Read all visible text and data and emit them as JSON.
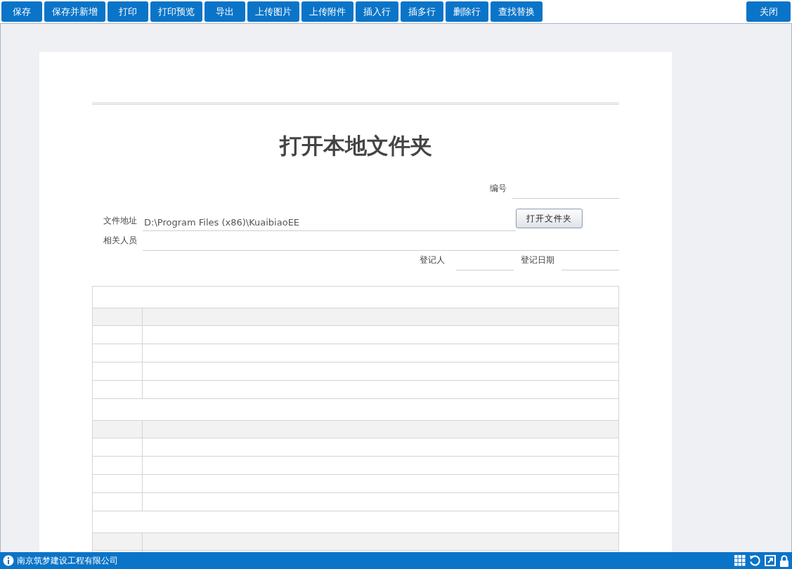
{
  "toolbar": {
    "buttons": [
      "保存",
      "保存并新增",
      "打印",
      "打印预览",
      "导出",
      "上传图片",
      "上传附件",
      "插入行",
      "插多行",
      "删除行",
      "查找替换"
    ],
    "close_button": "关闭"
  },
  "document": {
    "title": "打开本地文件夹",
    "number": {
      "label": "编号"
    },
    "file_path": {
      "label": "文件地址",
      "value": "D:\\Program Files (x86)\\KuaibiaoEE",
      "button": "打开文件夹"
    },
    "related_people": {
      "label": "相关人员"
    },
    "registrar": {
      "label": "登记人"
    },
    "register_date": {
      "label": "登记日期"
    }
  },
  "status_bar": {
    "company": "南京筑梦建设工程有限公司"
  }
}
